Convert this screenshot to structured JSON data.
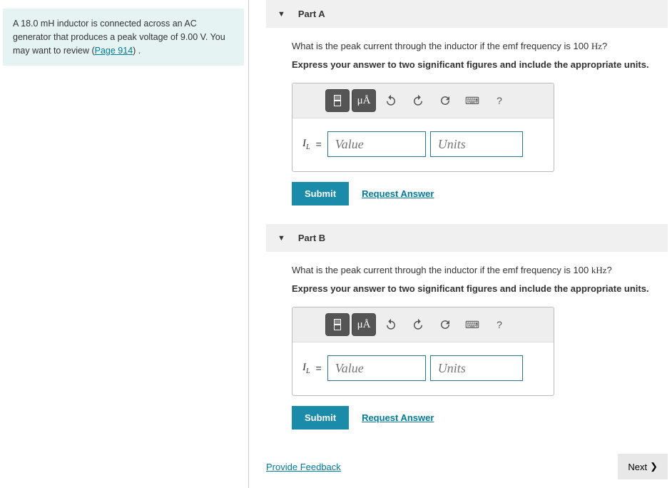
{
  "problem": {
    "text_before_link": "A 18.0 mH inductor is connected across an AC generator that produces a peak voltage of 9.00 V. You may want to review (",
    "link_text": "Page 914",
    "text_after_link": ") ."
  },
  "parts": [
    {
      "title": "Part A",
      "question_before": "What is the peak current through the inductor if the emf frequency is 100 ",
      "question_unit": "Hz",
      "question_after": "?",
      "instruction": "Express your answer to two significant figures and include the appropriate units.",
      "var_label": "I",
      "var_sub": "L",
      "value_placeholder": "Value",
      "units_placeholder": "Units",
      "submit_label": "Submit",
      "request_label": "Request Answer"
    },
    {
      "title": "Part B",
      "question_before": "What is the peak current through the inductor if the emf frequency is 100 ",
      "question_unit": "kHz",
      "question_after": "?",
      "instruction": "Express your answer to two significant figures and include the appropriate units.",
      "var_label": "I",
      "var_sub": "L",
      "value_placeholder": "Value",
      "units_placeholder": "Units",
      "submit_label": "Submit",
      "request_label": "Request Answer"
    }
  ],
  "toolbar": {
    "mu_a": "μÅ",
    "help": "?"
  },
  "footer": {
    "feedback": "Provide Feedback",
    "next": "Next"
  }
}
